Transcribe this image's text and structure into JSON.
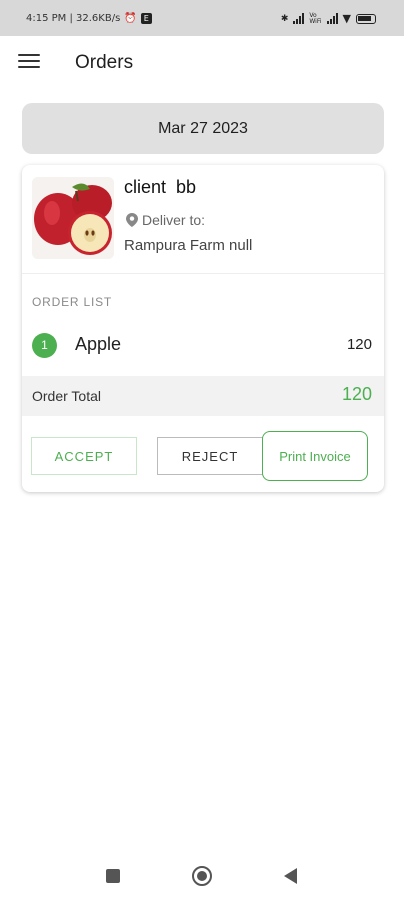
{
  "status_bar": {
    "time_speed": "4:15 PM | 32.6KB/s",
    "volte_label": "Vo\nWiFi",
    "icons": [
      "alarm-icon",
      "e-badge-icon",
      "bluetooth-icon",
      "signal-icon",
      "wifi-icon",
      "battery-icon"
    ]
  },
  "app_bar": {
    "title": "Orders",
    "menu_icon": "menu-icon"
  },
  "date_header": "Mar 27 2023",
  "order": {
    "client_name": "client  bb",
    "deliver_label": "Deliver to:",
    "address": "Rampura Farm null",
    "order_list_label": "ORDER LIST",
    "items": [
      {
        "index": "1",
        "name": "Apple",
        "quantity": "120"
      }
    ],
    "total_label": "Order Total",
    "total_value": "120",
    "buttons": {
      "accept": "ACCEPT",
      "reject": "REJECT",
      "print": "Print Invoice"
    }
  },
  "colors": {
    "accent_green": "#4caf50",
    "date_pill_bg": "#e0e0e0",
    "status_bar_bg": "#d8d8d8"
  },
  "nav_bar": {
    "icons": [
      "recents-icon",
      "home-icon",
      "back-icon"
    ]
  }
}
